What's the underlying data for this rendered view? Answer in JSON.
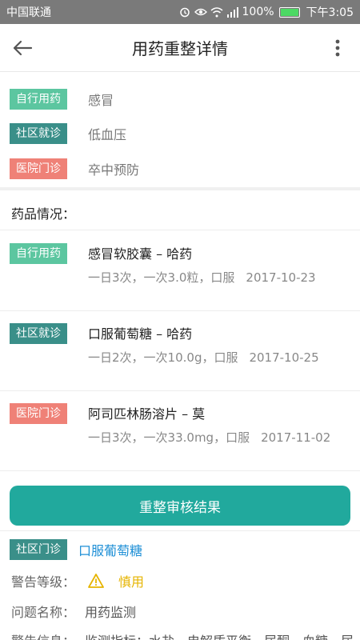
{
  "status_bar": {
    "carrier": "中国联通",
    "battery": "100%",
    "time": "下午3:05",
    "icons": [
      "alarm-icon",
      "eye-icon",
      "wifi-icon",
      "signal-icon",
      "battery-icon"
    ]
  },
  "app_bar": {
    "title": "用药重整详情",
    "back_icon": "arrow-left-icon",
    "more_icon": "more-vertical-icon"
  },
  "diagnoses": [
    {
      "tag": "自行用药",
      "text": "感冒",
      "tag_color": "#5cc6a0"
    },
    {
      "tag": "社区就诊",
      "text": "低血压",
      "tag_color": "#3a8f89"
    },
    {
      "tag": "医院门诊",
      "text": "卒中预防",
      "tag_color": "#ef8177"
    }
  ],
  "drugs_heading": "药品情况：",
  "drugs": [
    {
      "tag": "自行用药",
      "name": "感冒软胶囊 – 哈药",
      "info": "一日3次，一次3.0粒，口服",
      "date": "2017-10-23"
    },
    {
      "tag": "社区就诊",
      "name": "口服葡萄糖 – 哈药",
      "info": "一日2次，一次10.0g，口服",
      "date": "2017-10-25"
    },
    {
      "tag": "医院门诊",
      "name": "阿司匹林肠溶片 – 莫",
      "info": "一日3次，一次33.0mg，口服",
      "date": "2017-11-02"
    }
  ],
  "review_button": "重整审核结果",
  "result": {
    "tag": "社区门诊",
    "drug_link": "口服葡萄糖",
    "warning_level_label": "警告等级：",
    "warning_level_value": "慎用",
    "problem_label": "问题名称：",
    "problem_value": "用药监测",
    "warning_info_label": "警告信息：",
    "warning_info_value": "监测指标：水盐、电解质平衡、尿酮、血糖、尿"
  },
  "colors": {
    "accent": "#21a99d",
    "link": "#1e8fd6",
    "warning": "#e6b400"
  }
}
